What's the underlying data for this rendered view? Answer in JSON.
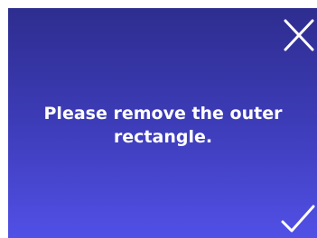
{
  "dialog": {
    "message": "Please remove the outer\nrectangle.",
    "close_icon": "close-icon",
    "confirm_icon": "checkmark-icon"
  },
  "colors": {
    "gradient_top": "#2e2d8f",
    "gradient_bottom": "#5150e6",
    "text": "#ffffff",
    "page_background": "#ffffff"
  }
}
